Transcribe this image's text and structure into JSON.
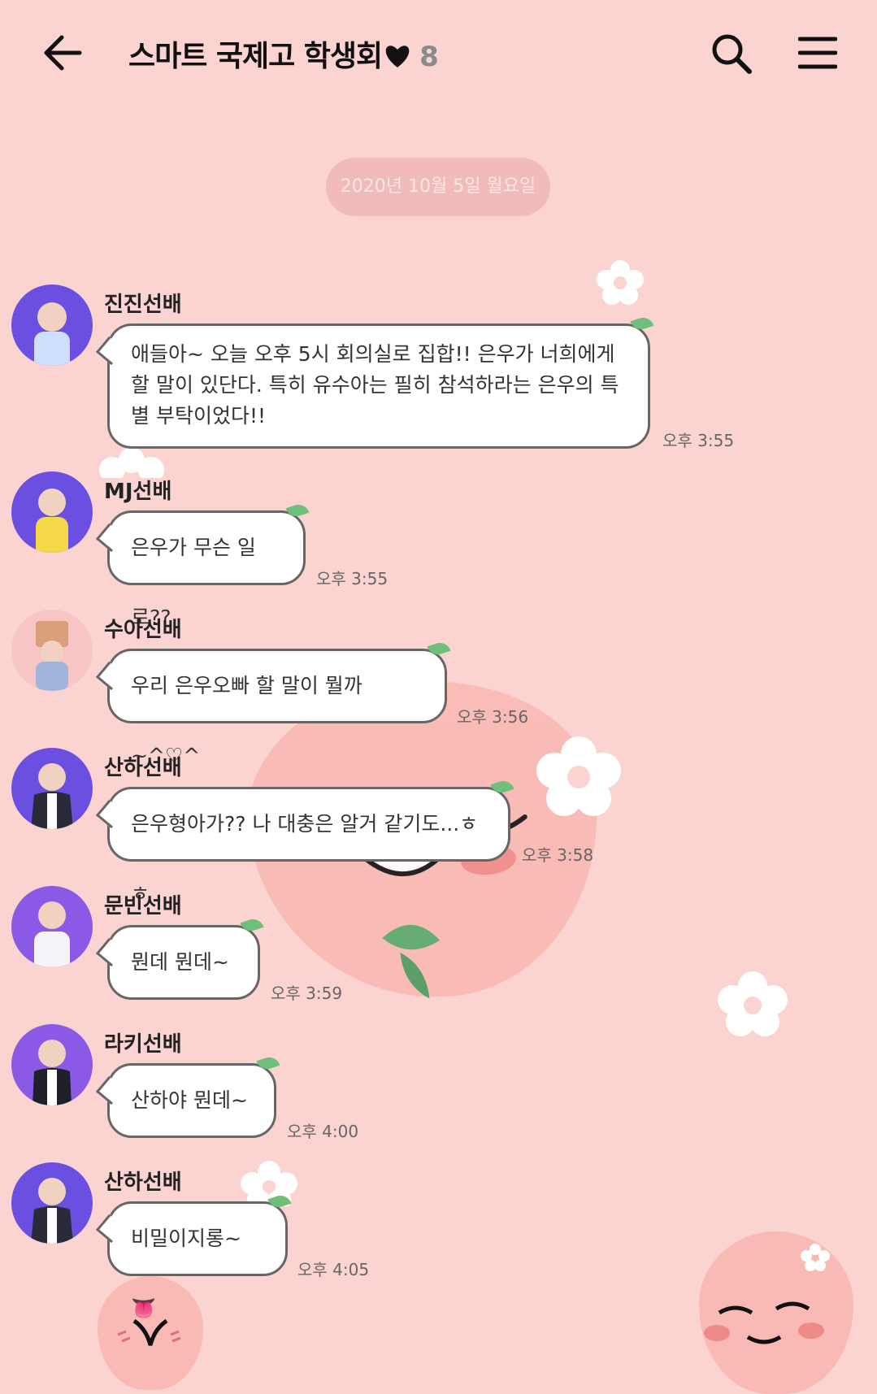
{
  "header": {
    "title": "스마트 국제고 학생회",
    "member_count": "8"
  },
  "date_chip": "2020년 10월 5일 월요일",
  "messages": [
    {
      "sender": "진진선배",
      "text": "애들아~ 오늘 오후 5시 회의실로 집합!! 은우가 너희에게 할 말이 있단다. 특히 유수아는 필히 참석하라는 은우의 특별 부탁이었다!!",
      "time": "오후 3:55",
      "avatar_color": "#6a4fe0"
    },
    {
      "sender": "MJ선배",
      "text": "은우가 무슨 일로??",
      "time": "오후 3:55",
      "avatar_color": "#6a4fe0"
    },
    {
      "sender": "수아선배",
      "text": "우리 은우오빠 할 말이 뭘까~^♡^",
      "time": "오후 3:56",
      "avatar_color": "#f7c5c5"
    },
    {
      "sender": "산하선배",
      "text": "은우형아가?? 나 대충은 알거 같기도...ㅎㅎ",
      "time": "오후 3:58",
      "avatar_color": "#6a4fe0"
    },
    {
      "sender": "문빈선배",
      "text": "뭔데 뭔데~",
      "time": "오후 3:59",
      "avatar_color": "#8a5ae6"
    },
    {
      "sender": "라키선배",
      "text": "산하야 뭔데~",
      "time": "오후 4:00",
      "avatar_color": "#8a5ae6"
    },
    {
      "sender": "산하선배",
      "text": "비밀이지롱~👅",
      "time": "오후 4:05",
      "avatar_color": "#6a4fe0"
    }
  ]
}
